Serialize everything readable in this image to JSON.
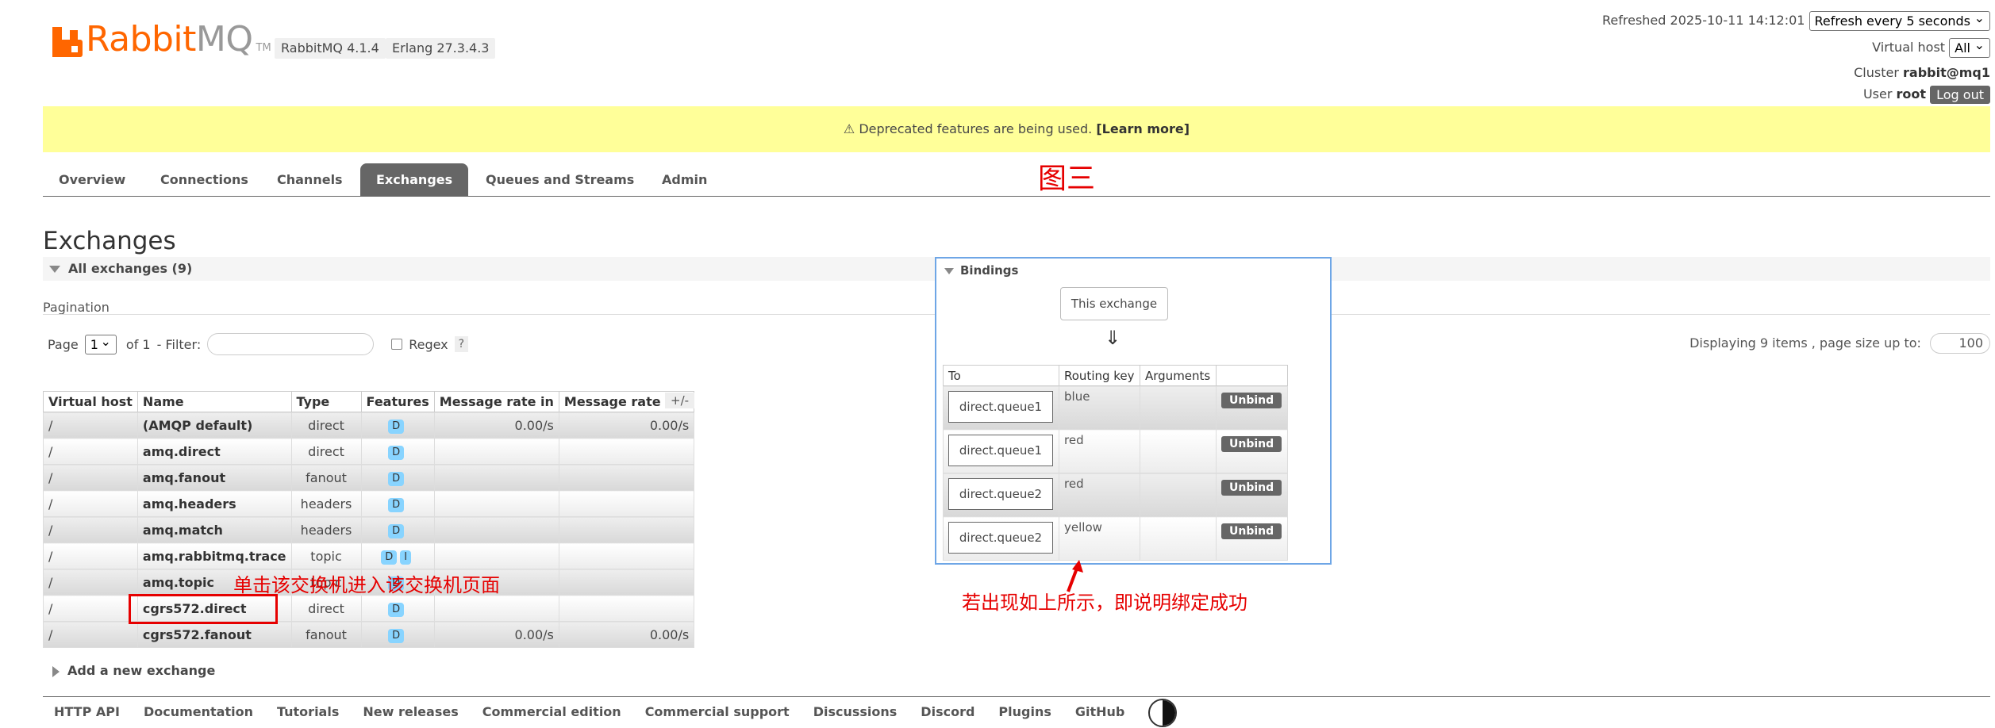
{
  "header": {
    "logo_text_rabbit": "Rabbit",
    "logo_text_mq": "MQ",
    "logo_tm": "TM",
    "version_rabbitmq": "RabbitMQ 4.1.4",
    "version_erlang": "Erlang 27.3.4.3",
    "refreshed_text": "Refreshed 2025-10-11 14:12:01",
    "refresh_select": "Refresh every 5 seconds",
    "virtual_host_label": "Virtual host",
    "virtual_host_value": "All",
    "cluster_label": "Cluster",
    "cluster_value": "rabbit@mq1",
    "user_label": "User",
    "user_value": "root",
    "logout_label": "Log out"
  },
  "banner": {
    "text": "⚠ Deprecated features are being used.",
    "link": "[Learn more]"
  },
  "tabs": [
    {
      "label": "Overview"
    },
    {
      "label": "Connections"
    },
    {
      "label": "Channels"
    },
    {
      "label": "Exchanges",
      "active": true
    },
    {
      "label": "Queues and Streams"
    },
    {
      "label": "Admin"
    }
  ],
  "annotations": {
    "figure_label": "图三",
    "click_hint": "单击该交换机进入该交换机页面",
    "success_hint": "若出现如上所示，即说明绑定成功"
  },
  "page": {
    "title": "Exchanges",
    "section_title": "All exchanges (9)",
    "pagination_label": "Pagination",
    "page_label": "Page",
    "page_value": "1",
    "of_label": "of 1",
    "filter_label": "- Filter:",
    "regex_label": "Regex",
    "help_label": "?",
    "displaying_text": "Displaying 9 items , page size up to:",
    "page_size": "100",
    "plus_minus": "+/-",
    "add_new": "Add a new exchange"
  },
  "table": {
    "headers": [
      "Virtual host",
      "Name",
      "Type",
      "Features",
      "Message rate in",
      "Message rate out"
    ],
    "rows": [
      {
        "vhost": "/",
        "name": "(AMQP default)",
        "type": "direct",
        "features": [
          "D"
        ],
        "rate_in": "0.00/s",
        "rate_out": "0.00/s"
      },
      {
        "vhost": "/",
        "name": "amq.direct",
        "type": "direct",
        "features": [
          "D"
        ],
        "rate_in": "",
        "rate_out": ""
      },
      {
        "vhost": "/",
        "name": "amq.fanout",
        "type": "fanout",
        "features": [
          "D"
        ],
        "rate_in": "",
        "rate_out": ""
      },
      {
        "vhost": "/",
        "name": "amq.headers",
        "type": "headers",
        "features": [
          "D"
        ],
        "rate_in": "",
        "rate_out": ""
      },
      {
        "vhost": "/",
        "name": "amq.match",
        "type": "headers",
        "features": [
          "D"
        ],
        "rate_in": "",
        "rate_out": ""
      },
      {
        "vhost": "/",
        "name": "amq.rabbitmq.trace",
        "type": "topic",
        "features": [
          "D",
          "I"
        ],
        "rate_in": "",
        "rate_out": ""
      },
      {
        "vhost": "/",
        "name": "amq.topic",
        "type": "topic",
        "features": [
          "D"
        ],
        "rate_in": "",
        "rate_out": ""
      },
      {
        "vhost": "/",
        "name": "cgrs572.direct",
        "type": "direct",
        "features": [
          "D"
        ],
        "rate_in": "",
        "rate_out": ""
      },
      {
        "vhost": "/",
        "name": "cgrs572.fanout",
        "type": "fanout",
        "features": [
          "D"
        ],
        "rate_in": "0.00/s",
        "rate_out": "0.00/s"
      }
    ]
  },
  "bindings": {
    "title": "Bindings",
    "this_exchange": "This exchange",
    "arrow": "⇓",
    "headers": [
      "To",
      "Routing key",
      "Arguments",
      ""
    ],
    "unbind_label": "Unbind",
    "rows": [
      {
        "to": "direct.queue1",
        "routing_key": "blue",
        "arguments": ""
      },
      {
        "to": "direct.queue1",
        "routing_key": "red",
        "arguments": ""
      },
      {
        "to": "direct.queue2",
        "routing_key": "red",
        "arguments": ""
      },
      {
        "to": "direct.queue2",
        "routing_key": "yellow",
        "arguments": ""
      }
    ]
  },
  "footer": {
    "links": [
      "HTTP API",
      "Documentation",
      "Tutorials",
      "New releases",
      "Commercial edition",
      "Commercial support",
      "Discussions",
      "Discord",
      "Plugins",
      "GitHub"
    ]
  },
  "colors": {
    "brand": "#ff6600",
    "annotation": "#e60000",
    "banner": "#ffff99",
    "feature_badge": "#88d4ff",
    "panel_border": "#6ea6e6"
  }
}
